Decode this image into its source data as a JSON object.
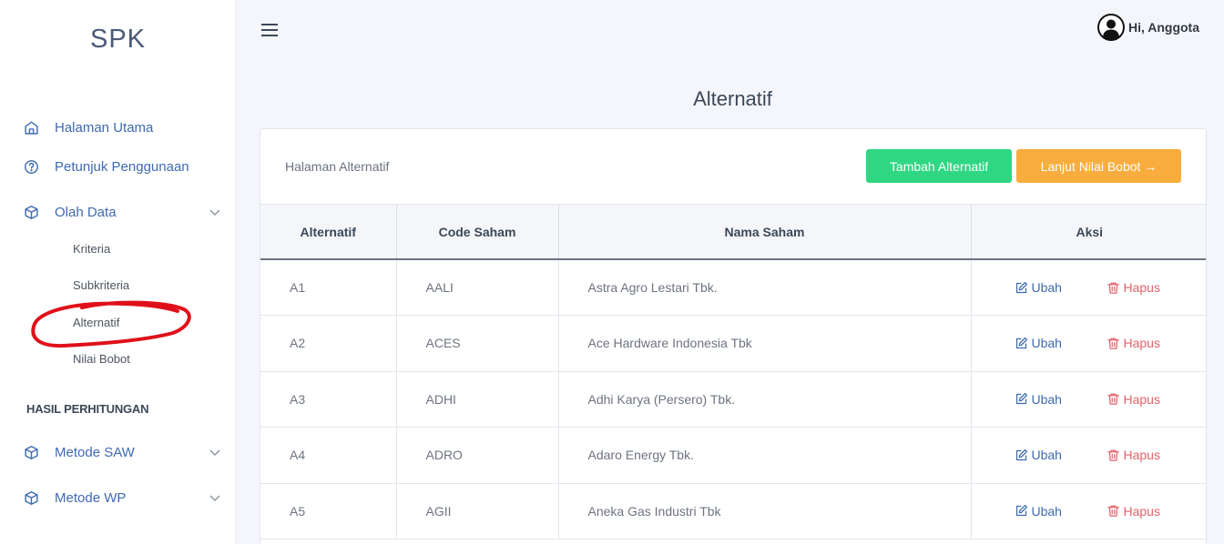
{
  "sidebar": {
    "brand": "SPK",
    "items": [
      {
        "label": "Halaman Utama",
        "icon": "home-icon"
      },
      {
        "label": "Petunjuk Penggunaan",
        "icon": "help-circle-icon"
      },
      {
        "label": "Olah Data",
        "icon": "box-icon"
      }
    ],
    "olah_data_sub": [
      "Kriteria",
      "Subkriteria",
      "Alternatif",
      "Nilai Bobot"
    ],
    "section_label": "HASIL PERHITUNGAN",
    "metode": [
      {
        "label": "Metode SAW",
        "icon": "box-icon"
      },
      {
        "label": "Metode WP",
        "icon": "box-icon"
      }
    ]
  },
  "topbar": {
    "greeting": "Hi, Anggota"
  },
  "page": {
    "title": "Alternatif",
    "card_title": "Halaman Alternatif",
    "btn_add": "Tambah Alternatif",
    "btn_next": "Lanjut Nilai Bobot →"
  },
  "table": {
    "headers": [
      "Alternatif",
      "Code Saham",
      "Nama Saham",
      "Aksi"
    ],
    "rows": [
      {
        "alt": "A1",
        "code": "AALI",
        "name": "Astra Agro Lestari Tbk."
      },
      {
        "alt": "A2",
        "code": "ACES",
        "name": "Ace Hardware Indonesia Tbk"
      },
      {
        "alt": "A3",
        "code": "ADHI",
        "name": "Adhi Karya (Persero) Tbk."
      },
      {
        "alt": "A4",
        "code": "ADRO",
        "name": "Adaro Energy Tbk."
      },
      {
        "alt": "A5",
        "code": "AGII",
        "name": "Aneka Gas Industri Tbk"
      }
    ],
    "edit_label": "Ubah",
    "delete_label": "Hapus"
  },
  "colors": {
    "accent": "#3f6ab0",
    "green": "#2fd783",
    "orange": "#f9ad3e",
    "danger": "#e3626a",
    "annotation": "#e0101a"
  }
}
